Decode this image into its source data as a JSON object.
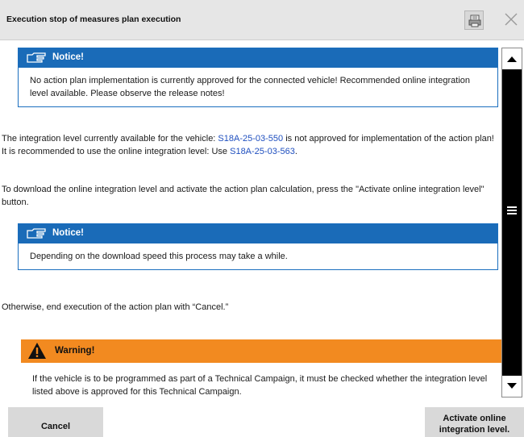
{
  "window": {
    "title": "Execution stop of measures plan execution",
    "print_icon": "printer-icon",
    "close_icon": "close-icon"
  },
  "notice1": {
    "icon": "pointing-hand-icon",
    "title": "Notice!",
    "text": "No action plan implementation is currently approved for the connected vehicle! Recommended online integration level available. Please observe the release notes!"
  },
  "paragraph1": {
    "part1": "The integration level currently available for the vehicle: ",
    "link1": "S18A-25-03-550",
    "part2": " is not approved for implementation of the action plan! It is recommended to use the online integration level:  Use ",
    "link2": "S18A-25-03-563",
    "part3": "."
  },
  "paragraph2": {
    "text": "To download the online integration level and activate the action plan calculation, press the \"Activate online integration level\" button."
  },
  "notice2": {
    "icon": "pointing-hand-icon",
    "title": "Notice!",
    "text": "Depending on the download speed this process may take a while."
  },
  "paragraph3": {
    "text": "Otherwise, end execution of the action plan with “Cancel.”"
  },
  "warning": {
    "icon": "warning-triangle-icon",
    "title": "Warning!",
    "text": "If the vehicle is to be programmed as part of a Technical Campaign, it must be checked whether the integration level listed above is approved for this Technical Campaign."
  },
  "scrollbar": {
    "up_icon": "arrow-up-icon",
    "down_icon": "arrow-down-icon",
    "grip_icon": "grip-icon"
  },
  "footer": {
    "cancel_label": "Cancel",
    "activate_label_line1": "Activate online",
    "activate_label_line2": "integration level."
  },
  "colors": {
    "notice_header": "#1a6bb8",
    "warning_header": "#f28a20",
    "link": "#1f4fbf",
    "button": "#d9d9d9"
  }
}
